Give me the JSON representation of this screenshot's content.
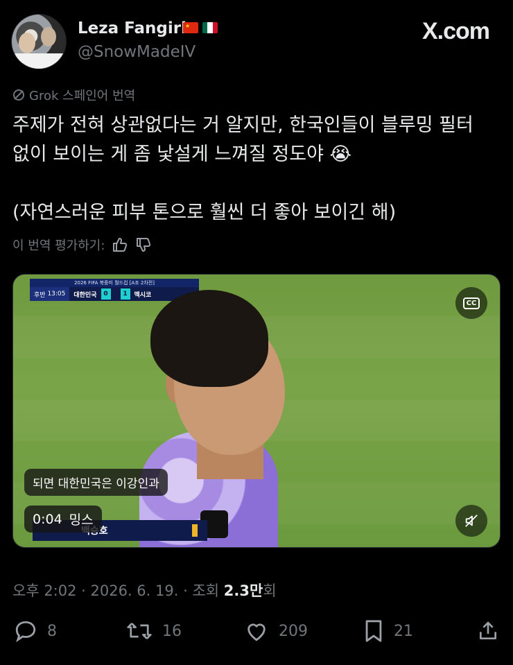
{
  "author": {
    "display_name": "Leza Fangirl",
    "handle": "@SnowMadeIV",
    "flags": [
      "china-flag",
      "mexico-flag"
    ]
  },
  "brand": {
    "label": "X.com"
  },
  "translation": {
    "label": "Grok 스페인어 번역",
    "rate_label": "이 번역 평가하기:"
  },
  "tweet": {
    "lines": [
      "주제가 전혀 상관없다는 거 알지만, 한국인들이 블루밍 필터",
      "없이 보이는 게 좀 낯설게 느껴질 정도야 😭",
      "(자연스러운 피부 톤으로 훨씬 더 좋아 보이긴 해)"
    ]
  },
  "media": {
    "score_header": "2026 FIFA 북중미 월드컵 [A조 2차전]",
    "period": "후반",
    "clock": "13:05",
    "home_team": "대한민국",
    "home_score": "0",
    "away_score": "1",
    "away_team": "멕시코",
    "caption": "되면 대한민국은 이강인과",
    "player_name": "백승호",
    "timestamp": "0:04",
    "uploader_label": "밍스",
    "cc_label": "CC"
  },
  "meta": {
    "time": "오후 2:02",
    "date": "2026. 6. 19.",
    "views_label": "조회",
    "views_value": "2.3만",
    "views_suffix": "회"
  },
  "actions": {
    "replies": "8",
    "reposts": "16",
    "likes": "209",
    "bookmarks": "21"
  },
  "colors": {
    "background": "#000000",
    "text": "#e7e9ea",
    "muted": "#71767b"
  }
}
